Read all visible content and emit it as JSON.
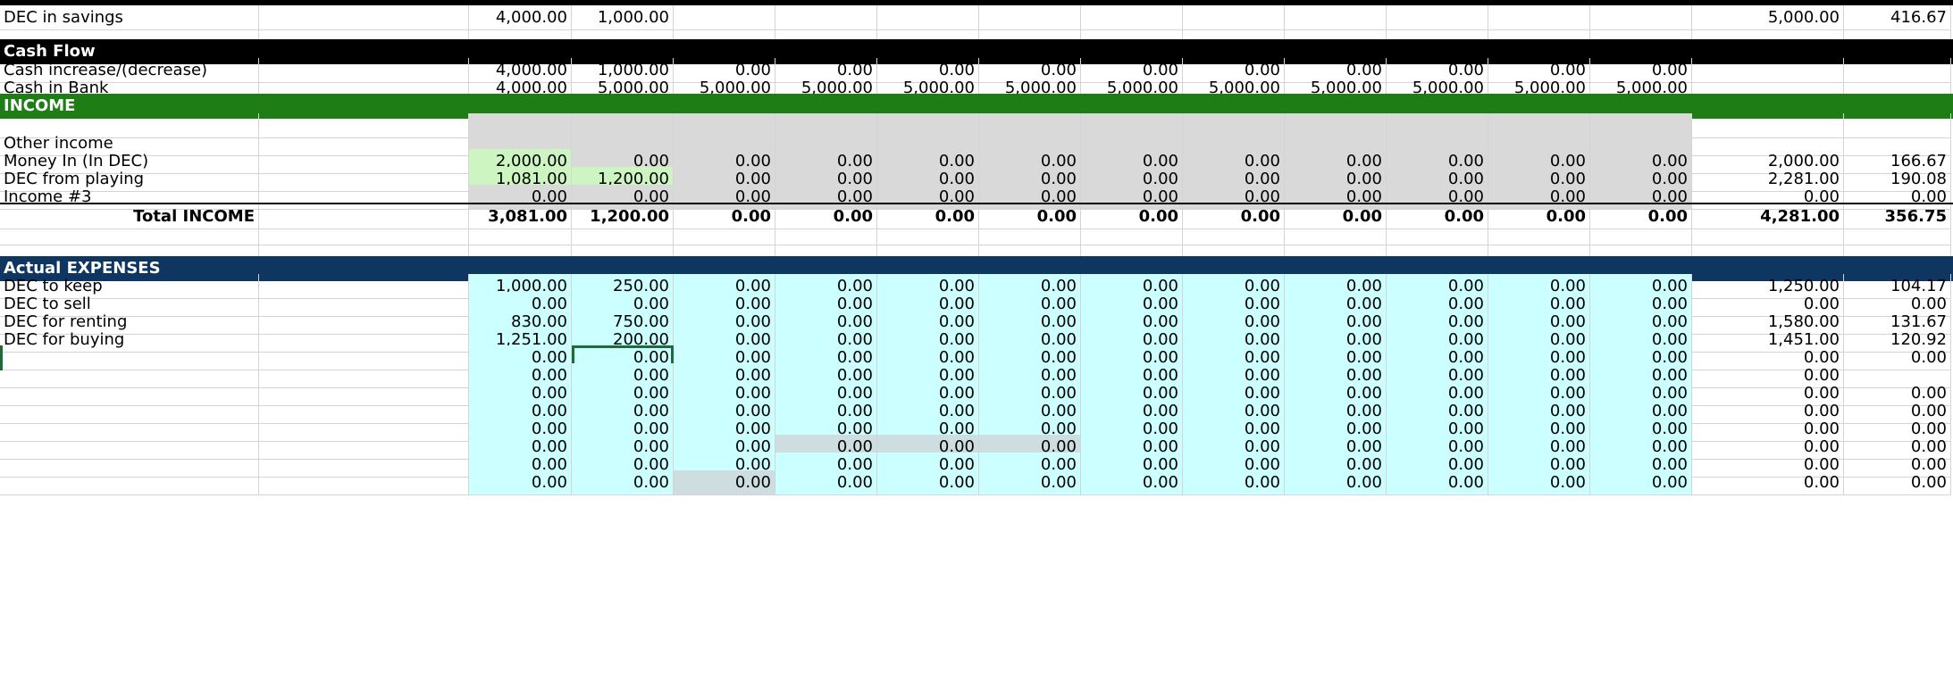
{
  "sheet": {
    "savings_row": {
      "label": "DEC in savings",
      "values": [
        "4,000.00",
        "1,000.00",
        "",
        "",
        "",
        "",
        "",
        "",
        "",
        "",
        "",
        ""
      ],
      "total": "5,000.00",
      "avg": "416.67"
    },
    "cash_flow": {
      "header": "Cash Flow",
      "increase": {
        "label": "Cash increase/(decrease)",
        "values": [
          "4,000.00",
          "1,000.00",
          "0.00",
          "0.00",
          "0.00",
          "0.00",
          "0.00",
          "0.00",
          "0.00",
          "0.00",
          "0.00",
          "0.00"
        ]
      },
      "bank": {
        "label": "Cash in Bank",
        "values": [
          "4,000.00",
          "5,000.00",
          "5,000.00",
          "5,000.00",
          "5,000.00",
          "5,000.00",
          "5,000.00",
          "5,000.00",
          "5,000.00",
          "5,000.00",
          "5,000.00",
          "5,000.00"
        ]
      }
    },
    "income": {
      "header": "INCOME",
      "other_label": "Other income",
      "rows": [
        {
          "label": "Money In (In DEC)",
          "values": [
            "2,000.00",
            "0.00",
            "0.00",
            "0.00",
            "0.00",
            "0.00",
            "0.00",
            "0.00",
            "0.00",
            "0.00",
            "0.00",
            "0.00"
          ],
          "total": "2,000.00",
          "avg": "166.67"
        },
        {
          "label": "DEC from playing",
          "values": [
            "1,081.00",
            "1,200.00",
            "0.00",
            "0.00",
            "0.00",
            "0.00",
            "0.00",
            "0.00",
            "0.00",
            "0.00",
            "0.00",
            "0.00"
          ],
          "total": "2,281.00",
          "avg": "190.08"
        },
        {
          "label": "Income #3",
          "values": [
            "0.00",
            "0.00",
            "0.00",
            "0.00",
            "0.00",
            "0.00",
            "0.00",
            "0.00",
            "0.00",
            "0.00",
            "0.00",
            "0.00"
          ],
          "total": "0.00",
          "avg": "0.00"
        }
      ],
      "total": {
        "label": "Total INCOME",
        "values": [
          "3,081.00",
          "1,200.00",
          "0.00",
          "0.00",
          "0.00",
          "0.00",
          "0.00",
          "0.00",
          "0.00",
          "0.00",
          "0.00",
          "0.00"
        ],
        "total": "4,281.00",
        "avg": "356.75"
      }
    },
    "expenses": {
      "header": "Actual EXPENSES",
      "rows": [
        {
          "label": "DEC to keep",
          "values": [
            "1,000.00",
            "250.00",
            "0.00",
            "0.00",
            "0.00",
            "0.00",
            "0.00",
            "0.00",
            "0.00",
            "0.00",
            "0.00",
            "0.00"
          ],
          "total": "1,250.00",
          "avg": "104.17"
        },
        {
          "label": "DEC to sell",
          "values": [
            "0.00",
            "0.00",
            "0.00",
            "0.00",
            "0.00",
            "0.00",
            "0.00",
            "0.00",
            "0.00",
            "0.00",
            "0.00",
            "0.00"
          ],
          "total": "0.00",
          "avg": "0.00"
        },
        {
          "label": "DEC for renting",
          "values": [
            "830.00",
            "750.00",
            "0.00",
            "0.00",
            "0.00",
            "0.00",
            "0.00",
            "0.00",
            "0.00",
            "0.00",
            "0.00",
            "0.00"
          ],
          "total": "1,580.00",
          "avg": "131.67"
        },
        {
          "label": "DEC for buying",
          "values": [
            "1,251.00",
            "200.00",
            "0.00",
            "0.00",
            "0.00",
            "0.00",
            "0.00",
            "0.00",
            "0.00",
            "0.00",
            "0.00",
            "0.00"
          ],
          "total": "1,451.00",
          "avg": "120.92"
        },
        {
          "label": "",
          "values": [
            "0.00",
            "0.00",
            "0.00",
            "0.00",
            "0.00",
            "0.00",
            "0.00",
            "0.00",
            "0.00",
            "0.00",
            "0.00",
            "0.00"
          ],
          "total": "0.00",
          "avg": "0.00"
        },
        {
          "label": "",
          "values": [
            "0.00",
            "0.00",
            "0.00",
            "0.00",
            "0.00",
            "0.00",
            "0.00",
            "0.00",
            "0.00",
            "0.00",
            "0.00",
            "0.00"
          ],
          "total": "0.00",
          "avg": ""
        },
        {
          "label": "",
          "values": [
            "0.00",
            "0.00",
            "0.00",
            "0.00",
            "0.00",
            "0.00",
            "0.00",
            "0.00",
            "0.00",
            "0.00",
            "0.00",
            "0.00"
          ],
          "total": "0.00",
          "avg": "0.00"
        },
        {
          "label": "",
          "values": [
            "0.00",
            "0.00",
            "0.00",
            "0.00",
            "0.00",
            "0.00",
            "0.00",
            "0.00",
            "0.00",
            "0.00",
            "0.00",
            "0.00"
          ],
          "total": "0.00",
          "avg": "0.00"
        },
        {
          "label": "",
          "values": [
            "0.00",
            "0.00",
            "0.00",
            "0.00",
            "0.00",
            "0.00",
            "0.00",
            "0.00",
            "0.00",
            "0.00",
            "0.00",
            "0.00"
          ],
          "total": "0.00",
          "avg": "0.00"
        },
        {
          "label": "",
          "values": [
            "0.00",
            "0.00",
            "0.00",
            "0.00",
            "0.00",
            "0.00",
            "0.00",
            "0.00",
            "0.00",
            "0.00",
            "0.00",
            "0.00"
          ],
          "total": "0.00",
          "avg": "0.00"
        },
        {
          "label": "",
          "values": [
            "0.00",
            "0.00",
            "0.00",
            "0.00",
            "0.00",
            "0.00",
            "0.00",
            "0.00",
            "0.00",
            "0.00",
            "0.00",
            "0.00"
          ],
          "total": "0.00",
          "avg": "0.00"
        },
        {
          "label": "",
          "values": [
            "0.00",
            "0.00",
            "0.00",
            "0.00",
            "0.00",
            "0.00",
            "0.00",
            "0.00",
            "0.00",
            "0.00",
            "0.00",
            "0.00"
          ],
          "total": "0.00",
          "avg": "0.00"
        }
      ]
    },
    "selected_cell": {
      "row": 4,
      "col": 1
    },
    "colors": {
      "cash_flow_band": "#000000",
      "income_band": "#1e7d14",
      "expense_band": "#0f3660",
      "income_input": "#ccf5c2",
      "expense_input": "#ccffff",
      "locked": "#d9d9d9"
    }
  }
}
